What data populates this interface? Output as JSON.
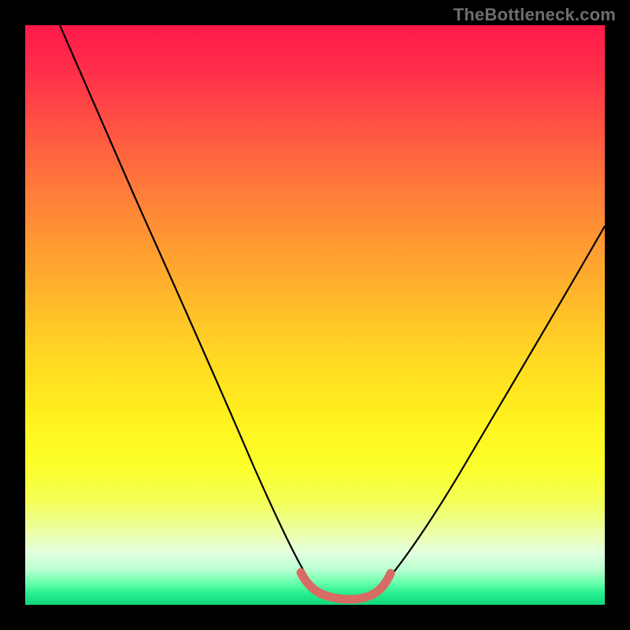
{
  "watermark": "TheBottleneck.com",
  "chart_data": {
    "type": "line",
    "title": "",
    "xlabel": "",
    "ylabel": "",
    "xlim": [
      0,
      100
    ],
    "ylim": [
      0,
      100
    ],
    "grid": false,
    "legend": false,
    "gradient_bands": [
      {
        "name": "red",
        "color": "#ff1a4b",
        "y_value": 100
      },
      {
        "name": "orange",
        "color": "#ff9a32",
        "y_value": 62
      },
      {
        "name": "yellow",
        "color": "#fff21e",
        "y_value": 32
      },
      {
        "name": "green",
        "color": "#11d67a",
        "y_value": 0
      }
    ],
    "series": [
      {
        "name": "bottleneck-curve",
        "color": "#000000",
        "x": [
          6,
          10,
          15,
          20,
          25,
          30,
          35,
          40,
          45,
          48,
          50,
          53,
          56,
          58,
          60,
          65,
          70,
          75,
          80,
          85,
          90,
          95,
          100
        ],
        "values": [
          100,
          93,
          84,
          75,
          66,
          56,
          46,
          36,
          24,
          14,
          7,
          3,
          2,
          2,
          3,
          7,
          14,
          22,
          31,
          40,
          49,
          58,
          67
        ]
      },
      {
        "name": "optimal-range-marker",
        "color": "#d86b63",
        "x": [
          48,
          50,
          52,
          54,
          56,
          58,
          60
        ],
        "values": [
          6,
          3.5,
          2.5,
          2,
          2.5,
          3.5,
          6
        ]
      }
    ]
  }
}
